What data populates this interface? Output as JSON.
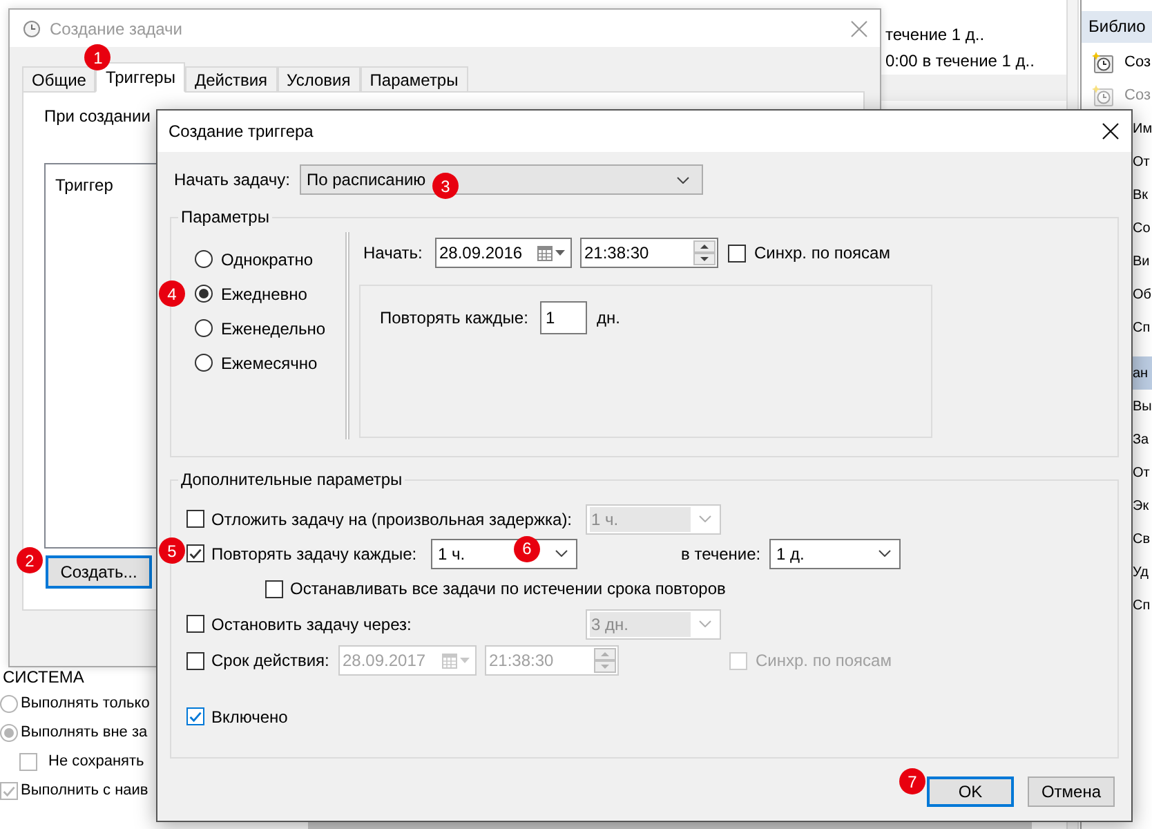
{
  "task_dialog": {
    "title": "Создание задачи",
    "active": false,
    "tabs": [
      {
        "label": "Общие",
        "selected": false
      },
      {
        "label": "Триггеры",
        "selected": true,
        "annotation": "1"
      },
      {
        "label": "Действия",
        "selected": false
      },
      {
        "label": "Условия",
        "selected": false
      },
      {
        "label": "Параметры",
        "selected": false
      }
    ],
    "intro": "При создании",
    "trigger_list": {
      "columns": [
        "Триггер"
      ]
    },
    "create_button": {
      "label": "Создать...",
      "focused": true,
      "annotation": "2"
    }
  },
  "task_list": {
    "rows": [
      {
        "text": "течение 1 д.."
      },
      {
        "text": "0:00 в течение 1 д.."
      }
    ]
  },
  "actions_panel": {
    "header": "Библио",
    "items": [
      {
        "kind": "icon",
        "label": "Соз",
        "disabled": false
      },
      {
        "kind": "icon",
        "label": "Соз",
        "disabled": true
      },
      {
        "kind": "text",
        "label": "Им",
        "disabled": false
      },
      {
        "kind": "text",
        "label": "От",
        "disabled": false
      },
      {
        "kind": "text",
        "label": "Вк",
        "disabled": false
      },
      {
        "kind": "text",
        "label": "Со",
        "disabled": false
      },
      {
        "kind": "text",
        "label": "Ви",
        "disabled": false
      },
      {
        "kind": "text",
        "label": "Об",
        "disabled": false
      },
      {
        "kind": "text",
        "label": "Сп",
        "disabled": false
      },
      {
        "kind": "section",
        "label": "ан",
        "disabled": false
      },
      {
        "kind": "text",
        "label": "Вы",
        "disabled": false
      },
      {
        "kind": "text",
        "label": "За",
        "disabled": false
      },
      {
        "kind": "text",
        "label": "От",
        "disabled": false
      },
      {
        "kind": "text",
        "label": "Эк",
        "disabled": false
      },
      {
        "kind": "text",
        "label": "Св",
        "disabled": false
      },
      {
        "kind": "text",
        "label": "Уд",
        "disabled": false
      },
      {
        "kind": "text",
        "label": "Сп",
        "disabled": false
      }
    ]
  },
  "trigger_dialog": {
    "title": "Создание триггера",
    "active": true,
    "start_task": {
      "label": "Начать задачу:",
      "value": "По расписанию",
      "annotation": "3"
    },
    "schedule": {
      "title": "Параметры",
      "frequencies": [
        {
          "label": "Однократно",
          "selected": false
        },
        {
          "label": "Ежедневно",
          "selected": true,
          "annotation": "4"
        },
        {
          "label": "Еженедельно",
          "selected": false
        },
        {
          "label": "Ежемесячно",
          "selected": false
        }
      ],
      "start": {
        "label": "Начать:",
        "date": "28.09.2016",
        "time": "21:38:30",
        "sync_label": "Синхр. по поясам",
        "sync_checked": false
      },
      "recur": {
        "label": "Повторять каждые:",
        "value": "1",
        "unit": "дн."
      }
    },
    "advanced": {
      "title": "Дополнительные параметры",
      "rows": [
        {
          "kind": "dropdown",
          "label": "Отложить задачу на (произвольная задержка):",
          "checked": false,
          "value": "1 ч.",
          "disabled": true
        },
        {
          "kind": "repeat",
          "label": "Повторять задачу каждые:",
          "checked": true,
          "annotation": "5",
          "value": "1 ч.",
          "value_annotation": "6",
          "duration_label": "в течение:",
          "duration": "1 д.",
          "children": [
            {
              "kind": "plain",
              "label": "Останавливать все задачи по истечении срока повторов",
              "checked": false
            }
          ]
        },
        {
          "kind": "dropdown",
          "label": "Остановить задачу через:",
          "checked": false,
          "value": "3 дн.",
          "disabled": true
        },
        {
          "kind": "expiry",
          "label": "Срок действия:",
          "checked": false,
          "date": "28.09.2017",
          "time": "21:38:30",
          "disabled": true,
          "sync_label": "Синхр. по поясам",
          "sync_checked": false
        },
        {
          "kind": "plain",
          "label": "Включено",
          "checked": true,
          "hover": true
        }
      ]
    },
    "buttons": [
      {
        "label": "OK",
        "focused": true,
        "annotation": "7"
      },
      {
        "label": "Отмена",
        "focused": false
      }
    ]
  },
  "background_properties": {
    "section_title": "СИСТЕМА",
    "options": [
      {
        "kind": "radio",
        "label": "Выполнять только",
        "selected": false
      },
      {
        "kind": "radio",
        "label": "Выполнять вне за",
        "selected": true,
        "children": [
          {
            "kind": "checkbox",
            "label": "Не сохранять",
            "checked": false
          }
        ]
      },
      {
        "kind": "checkbox",
        "label": "Выполнить с наив",
        "checked": true
      }
    ]
  }
}
